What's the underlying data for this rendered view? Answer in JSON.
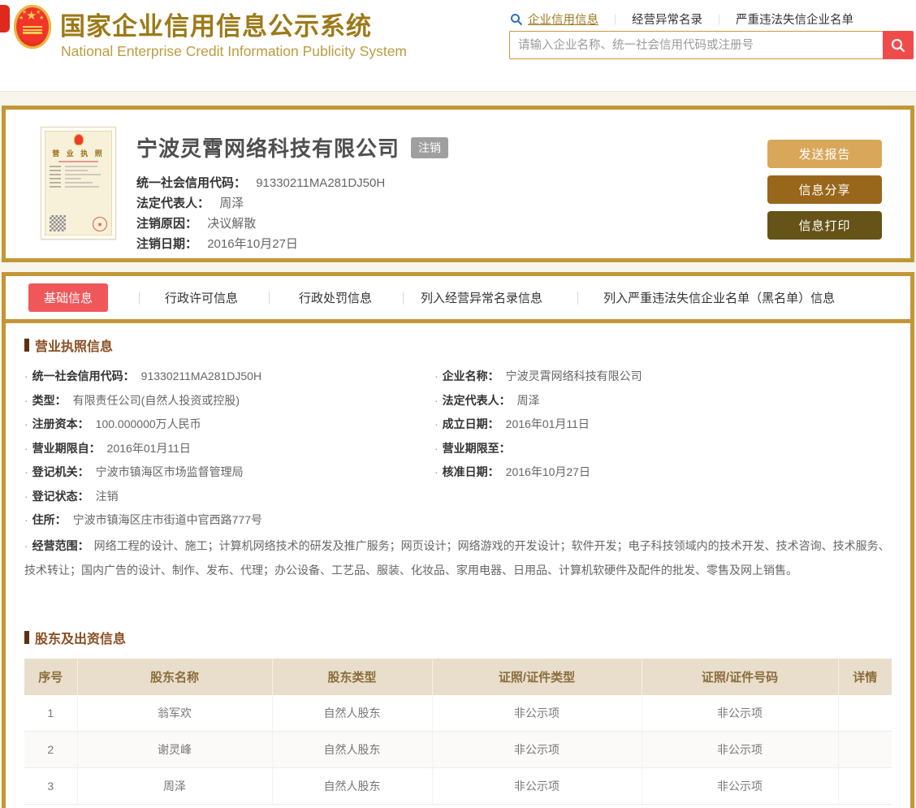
{
  "header": {
    "site_title": "国家企业信用信息公示系统",
    "site_subtitle": "National Enterprise Credit Information Publicity System",
    "nav_links": [
      {
        "label": "企业信用信息"
      },
      {
        "label": "经营异常名录"
      },
      {
        "label": "严重违法失信企业名单"
      }
    ],
    "search_placeholder": "请输入企业名称、统一社会信用代码或注册号"
  },
  "company_card": {
    "name": "宁波灵霄网络科技有限公司",
    "status_badge": "注销",
    "license_title": "营 业 执 照",
    "fields": [
      {
        "label": "统一社会信用代码：",
        "value": "91330211MA281DJ50H"
      },
      {
        "label": "法定代表人：",
        "value": "周泽"
      },
      {
        "label": "注销原因：",
        "value": "决议解散"
      },
      {
        "label": "注销日期：",
        "value": "2016年10月27日"
      }
    ],
    "buttons": [
      {
        "label": "发送报告"
      },
      {
        "label": "信息分享"
      },
      {
        "label": "信息打印"
      }
    ]
  },
  "tabs": [
    {
      "label": "基础信息",
      "active": true
    },
    {
      "label": "行政许可信息",
      "active": false
    },
    {
      "label": "行政处罚信息",
      "active": false
    },
    {
      "label": "列入经营异常名录信息",
      "active": false
    },
    {
      "label": "列入严重违法失信企业名单（黑名单）信息",
      "active": false
    }
  ],
  "license_section": {
    "title": "营业执照信息",
    "left_fields": [
      {
        "label": "统一社会信用代码：",
        "value": "91330211MA281DJ50H"
      },
      {
        "label": "类型：",
        "value": "有限责任公司(自然人投资或控股)"
      },
      {
        "label": "注册资本：",
        "value": "100.000000万人民币"
      },
      {
        "label": "营业期限自：",
        "value": "2016年01月11日"
      },
      {
        "label": "登记机关：",
        "value": "宁波市镇海区市场监督管理局"
      },
      {
        "label": "登记状态：",
        "value": "注销"
      },
      {
        "label": "住所：",
        "value": "宁波市镇海区庄市街道中官西路777号"
      }
    ],
    "right_fields": [
      {
        "label": "企业名称：",
        "value": "宁波灵霄网络科技有限公司"
      },
      {
        "label": "法定代表人：",
        "value": "周泽"
      },
      {
        "label": "成立日期：",
        "value": "2016年01月11日"
      },
      {
        "label": "营业期限至：",
        "value": ""
      },
      {
        "label": "核准日期：",
        "value": "2016年10月27日"
      }
    ],
    "scope_field": {
      "label": "经营范围：",
      "value": "网络工程的设计、施工；计算机网络技术的研发及推广服务；网页设计；网络游戏的开发设计；软件开发；电子科技领域内的技术开发、技术咨询、技术服务、技术转让；国内广告的设计、制作、发布、代理；办公设备、工艺品、服装、化妆品、家用电器、日用品、计算机软硬件及配件的批发、零售及网上销售。"
    }
  },
  "shareholder_section": {
    "title": "股东及出资信息",
    "table": {
      "headers": [
        "序号",
        "股东名称",
        "股东类型",
        "证照/证件类型",
        "证照/证件号码",
        "详情"
      ],
      "rows": [
        {
          "no": "1",
          "name": "翁军欢",
          "type": "自然人股东",
          "cert_type": "非公示项",
          "cert_no": "非公示项",
          "detail": ""
        },
        {
          "no": "2",
          "name": "谢灵峰",
          "type": "自然人股东",
          "cert_type": "非公示项",
          "cert_no": "非公示项",
          "detail": ""
        },
        {
          "no": "3",
          "name": "周泽",
          "type": "自然人股东",
          "cert_type": "非公示项",
          "cert_no": "非公示项",
          "detail": ""
        }
      ]
    }
  },
  "colors": {
    "gold_border": "#c39638",
    "title_gold": "#9d7a17",
    "accent_red": "#f0575a",
    "search_button_red": "#f04b4b",
    "button_send": "#d8a75a",
    "button_share": "#99671c",
    "button_print": "#655317",
    "table_header_bg": "#e9decb",
    "table_header_text": "#8a6d3b",
    "section_title_text": "#8a4e22",
    "badge_gray": "#9f9f9f",
    "page_bg": "#f8f5ec"
  }
}
